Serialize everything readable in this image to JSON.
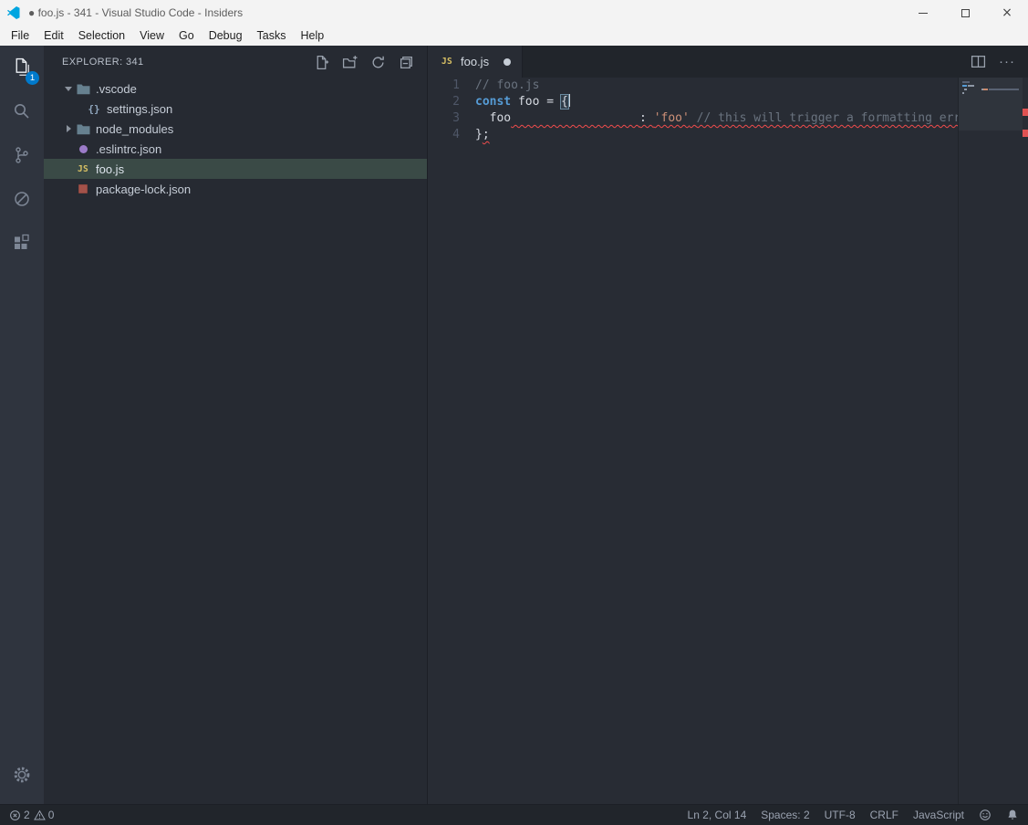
{
  "window": {
    "title": "● foo.js - 341 - Visual Studio Code - Insiders"
  },
  "menu_bar": {
    "items": [
      "File",
      "Edit",
      "Selection",
      "View",
      "Go",
      "Debug",
      "Tasks",
      "Help"
    ]
  },
  "activity_bar": {
    "items": [
      {
        "id": "explorer",
        "icon": "files-icon",
        "active": true,
        "badge": "1"
      },
      {
        "id": "search",
        "icon": "search-icon"
      },
      {
        "id": "source-control",
        "icon": "source-control-icon"
      },
      {
        "id": "debug",
        "icon": "debug-icon"
      },
      {
        "id": "extensions",
        "icon": "extensions-icon"
      }
    ],
    "bottom": [
      {
        "id": "settings",
        "icon": "gear-icon"
      }
    ]
  },
  "sidebar": {
    "header": "EXPLORER: 341",
    "actions": [
      {
        "id": "new-file",
        "icon": "new-file-icon"
      },
      {
        "id": "new-folder",
        "icon": "new-folder-icon"
      },
      {
        "id": "refresh",
        "icon": "refresh-icon"
      },
      {
        "id": "collapse-all",
        "icon": "collapse-all-icon"
      }
    ],
    "tree": [
      {
        "label": ".vscode",
        "icon": "folder",
        "indent": 0,
        "twisty": "expanded"
      },
      {
        "label": "settings.json",
        "icon": "braces",
        "indent": 1
      },
      {
        "label": "node_modules",
        "icon": "folder",
        "indent": 0,
        "twisty": "collapsed"
      },
      {
        "label": ".eslintrc.json",
        "icon": "eslint",
        "indent": 0
      },
      {
        "label": "foo.js",
        "icon": "js",
        "indent": 0,
        "selected": true
      },
      {
        "label": "package-lock.json",
        "icon": "npm",
        "indent": 0
      }
    ]
  },
  "editor": {
    "tab": {
      "label": "foo.js",
      "modified": true
    },
    "more_actions_label": "···",
    "lines": [
      {
        "num": "1",
        "tokens": [
          {
            "t": "// foo.js",
            "c": "comment"
          }
        ]
      },
      {
        "num": "2",
        "tokens": [
          {
            "t": "const",
            "c": "keyword"
          },
          {
            "t": " ",
            "c": "plain"
          },
          {
            "t": "foo",
            "c": "variable"
          },
          {
            "t": " = ",
            "c": "plain"
          },
          {
            "t": "{",
            "c": "plain",
            "match": true
          },
          {
            "t": "",
            "cursor": true
          }
        ]
      },
      {
        "num": "3",
        "tokens": [
          {
            "t": "  ",
            "c": "plain"
          },
          {
            "t": "foo",
            "c": "variable"
          },
          {
            "t": "                  ",
            "c": "plain",
            "sq": true
          },
          {
            "t": ": ",
            "c": "plain",
            "sq": true
          },
          {
            "t": "'foo'",
            "c": "string",
            "sq": true
          },
          {
            "t": " ",
            "c": "plain",
            "sq": true
          },
          {
            "t": "// this will trigger a formatting err",
            "c": "comment",
            "sq": true
          }
        ]
      },
      {
        "num": "4",
        "tokens": [
          {
            "t": "}",
            "c": "plain"
          },
          {
            "t": ";",
            "c": "plain",
            "sq": true
          }
        ]
      }
    ],
    "ruler_marks": [
      34,
      57
    ]
  },
  "status_bar": {
    "errors": "2",
    "warnings": "0",
    "right_items": [
      {
        "id": "cursor-position",
        "label": "Ln 2, Col 14"
      },
      {
        "id": "indentation",
        "label": "Spaces: 2"
      },
      {
        "id": "encoding",
        "label": "UTF-8"
      },
      {
        "id": "eol",
        "label": "CRLF"
      },
      {
        "id": "language",
        "label": "JavaScript"
      }
    ]
  },
  "colors": {
    "accent": "#007acc",
    "error": "#f14c4c",
    "selection_row": "#3a4a46",
    "string": "#ce9178",
    "keyword": "#569cd6"
  }
}
